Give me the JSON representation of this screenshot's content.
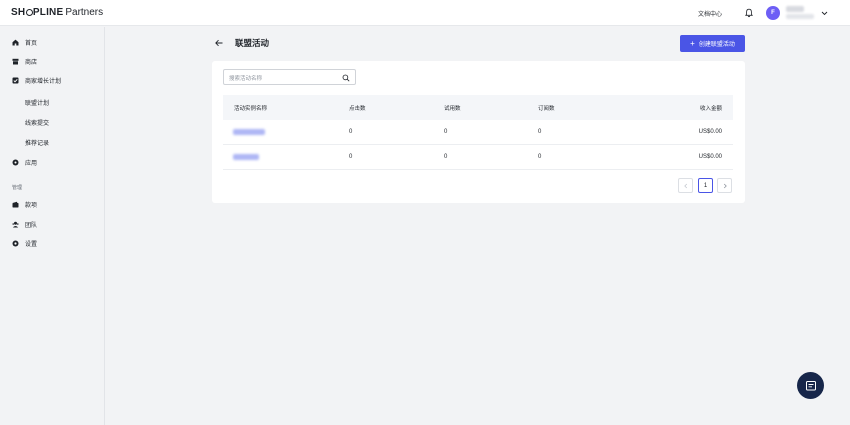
{
  "topbar": {
    "brand": {
      "pre": "SH",
      "post": "PLINE",
      "suffix": "Partners"
    },
    "doc_center": "文档中心",
    "avatar_initial": "F"
  },
  "sidebar": {
    "items": [
      {
        "label": "首页",
        "icon": "home-icon"
      },
      {
        "label": "商店",
        "icon": "store-icon"
      },
      {
        "label": "商家增长计划",
        "icon": "growth-plan-icon"
      }
    ],
    "sub_items": [
      "联盟计划",
      "线索提交",
      "推荐记录"
    ],
    "apps": {
      "label": "应用",
      "icon": "apps-icon"
    },
    "section_label": "管理",
    "manage_items": [
      {
        "label": "款项",
        "icon": "wallet-icon"
      },
      {
        "label": "团队",
        "icon": "team-icon"
      },
      {
        "label": "设置",
        "icon": "settings-icon"
      }
    ]
  },
  "main": {
    "title": "联盟活动",
    "create_button": "创建联盟活动",
    "search_placeholder": "搜索活动名称",
    "columns": [
      "活动实例名称",
      "点击数",
      "试用数",
      "订阅数",
      "收入金额"
    ],
    "rows": [
      {
        "clicks": "0",
        "trials": "0",
        "subscriptions": "0",
        "revenue": "US$0.00"
      },
      {
        "clicks": "0",
        "trials": "0",
        "subscriptions": "0",
        "revenue": "US$0.00"
      }
    ],
    "pagination": {
      "current_page": "1"
    }
  },
  "colors": {
    "accent": "#4a55e6",
    "avatar": "#6d5ef5",
    "chat": "#17264a"
  }
}
